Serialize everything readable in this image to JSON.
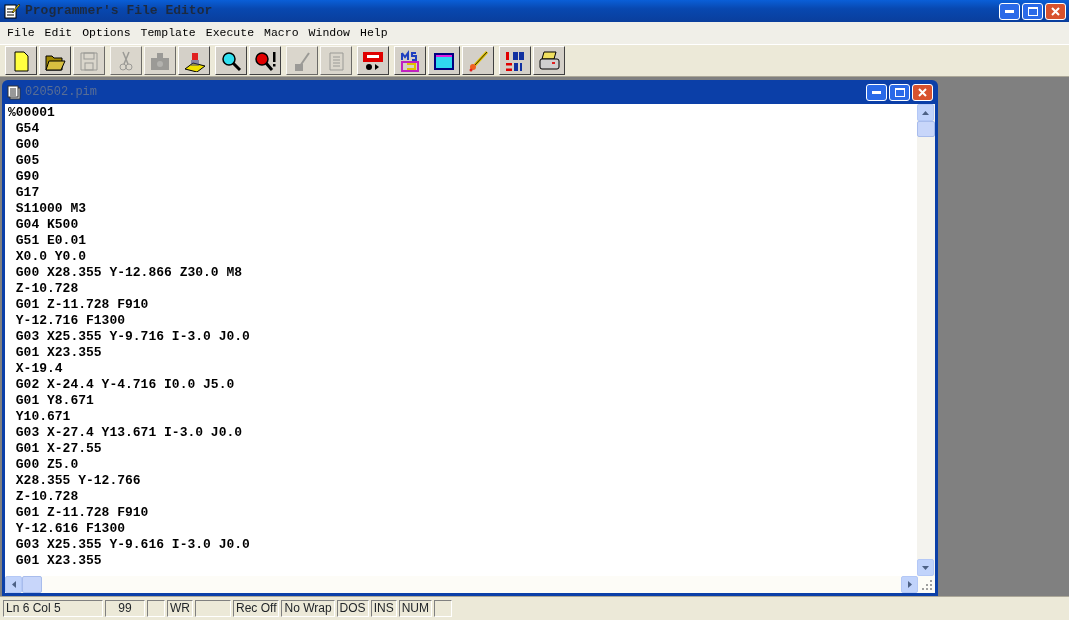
{
  "window": {
    "title": "Programmer's File Editor"
  },
  "menu": [
    "File",
    "Edit",
    "Options",
    "Template",
    "Execute",
    "Macro",
    "Window",
    "Help"
  ],
  "toolbar": [
    [
      {
        "kind": "new",
        "disabled": false
      },
      {
        "kind": "open",
        "disabled": false
      },
      {
        "kind": "save",
        "disabled": true
      }
    ],
    [
      {
        "kind": "cut",
        "disabled": true
      },
      {
        "kind": "copy",
        "disabled": true
      },
      {
        "kind": "paste",
        "disabled": false
      }
    ],
    [
      {
        "kind": "find",
        "disabled": false
      },
      {
        "kind": "findnext",
        "disabled": false
      }
    ],
    [
      {
        "kind": "tool",
        "disabled": true
      },
      {
        "kind": "page",
        "disabled": true
      }
    ],
    [
      {
        "kind": "record",
        "disabled": false
      }
    ],
    [
      {
        "kind": "dos",
        "disabled": false
      },
      {
        "kind": "console",
        "disabled": false
      },
      {
        "kind": "wand",
        "disabled": false
      }
    ],
    [
      {
        "kind": "sort",
        "disabled": false
      },
      {
        "kind": "print",
        "disabled": false
      }
    ]
  ],
  "document": {
    "title": "020502.pim",
    "lines": [
      "%00001",
      " G54",
      " G00",
      " G05",
      " G90",
      " G17",
      " S11000 M3",
      " G04 K500",
      " G51 E0.01",
      " X0.0 Y0.0",
      " G00 X28.355 Y-12.866 Z30.0 M8",
      " Z-10.728",
      " G01 Z-11.728 F910",
      " Y-12.716 F1300",
      " G03 X25.355 Y-9.716 I-3.0 J0.0",
      " G01 X23.355",
      " X-19.4",
      " G02 X-24.4 Y-4.716 I0.0 J5.0",
      " G01 Y8.671",
      " Y10.671",
      " G03 X-27.4 Y13.671 I-3.0 J0.0",
      " G01 X-27.55",
      " G00 Z5.0",
      " X28.355 Y-12.766",
      " Z-10.728",
      " G01 Z-11.728 F910",
      " Y-12.616 F1300",
      " G03 X25.355 Y-9.616 I-3.0 J0.0",
      " G01 X23.355"
    ]
  },
  "status_bar": [
    {
      "kind": "text",
      "text": "Ln 6 Col 5"
    },
    {
      "kind": "text",
      "text": "99"
    },
    {
      "kind": "blank"
    },
    {
      "kind": "text",
      "text": "WR"
    },
    {
      "kind": "blank"
    },
    {
      "kind": "text",
      "text": "Rec Off"
    },
    {
      "kind": "text",
      "text": "No Wrap"
    },
    {
      "kind": "text",
      "text": "DOS"
    },
    {
      "kind": "text",
      "text": "INS"
    },
    {
      "kind": "text",
      "text": "NUM"
    },
    {
      "kind": "blank"
    }
  ]
}
